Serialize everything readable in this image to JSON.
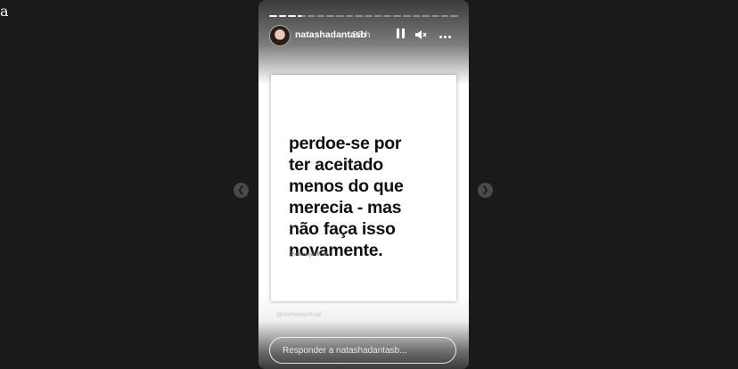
{
  "brand": {
    "mark": "a"
  },
  "story": {
    "progress": {
      "total_segments": 20,
      "completed": 3,
      "current_fraction": 0.5
    },
    "user": {
      "username": "natashadantasb",
      "time_ago": "23 h"
    },
    "controls": [
      "pause-icon",
      "mute-icon",
      "more-icon"
    ],
    "content": {
      "quote": "perdoe-se por\nter aceitado\nmenos do que\nmerecia - mas\nnão faça isso\nnovamente.",
      "credit": "@xoinvejaoficial",
      "faint_caption": "@xoinvejaoficial"
    },
    "reply": {
      "placeholder": "Responder a natashadantasb..."
    }
  },
  "navigation": {
    "prev_icon": "chevron-left-icon",
    "next_icon": "chevron-right-icon"
  }
}
